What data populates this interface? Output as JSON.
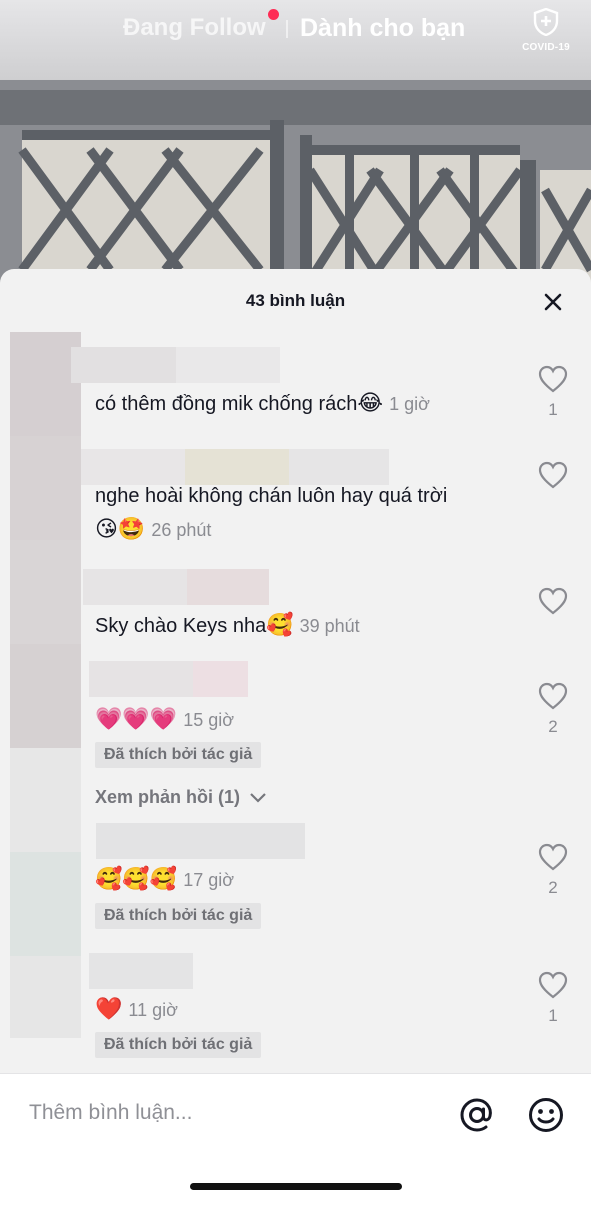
{
  "nav": {
    "following_label": "Đang Follow",
    "for_you_label": "Dành cho bạn",
    "covid_label": "COVID-19"
  },
  "comments_panel": {
    "title": "43 bình luận",
    "comments": [
      {
        "text": "có thêm đồng mik chống rách",
        "emoji": "😂",
        "time": "1 giờ",
        "likes": "1"
      },
      {
        "text": "nghe hoài không chán luôn hay quá trời",
        "emoji": "😘🤩",
        "time": "26 phút",
        "likes": ""
      },
      {
        "text": "Sky chào Keys nha",
        "emoji": "🥰",
        "time": "39 phút",
        "likes": ""
      },
      {
        "text": "",
        "emoji": "💗💗💗",
        "time": "15 giờ",
        "likes": "2",
        "liked_by_author": "Đã thích bởi tác giả",
        "view_replies": "Xem phản hồi (1)"
      },
      {
        "text": "",
        "emoji": "🥰🥰🥰",
        "time": "17 giờ",
        "likes": "2",
        "liked_by_author": "Đã thích bởi tác giả"
      },
      {
        "text": "",
        "emoji": "❤️",
        "time": "11 giờ",
        "likes": "1",
        "liked_by_author": "Đã thích bởi tác giả"
      }
    ]
  },
  "composer": {
    "placeholder": "Thêm bình luận..."
  },
  "colors": {
    "accent": "#fe2c55",
    "panel_bg": "#f2f2f2",
    "text_primary": "#161823",
    "text_secondary": "#8a8b91"
  }
}
